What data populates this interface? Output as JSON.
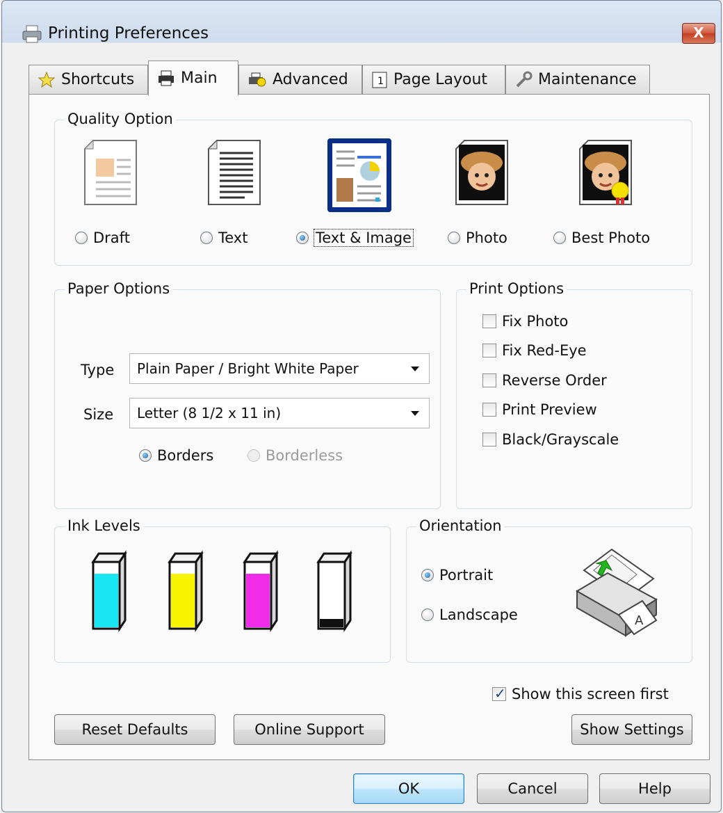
{
  "window": {
    "title": "Printing Preferences",
    "close_label": "X"
  },
  "tabs": [
    {
      "label": "Shortcuts",
      "icon": "star-icon"
    },
    {
      "label": "Main",
      "icon": "printer-icon",
      "active": true
    },
    {
      "label": "Advanced",
      "icon": "gear-printer-icon"
    },
    {
      "label": "Page Layout",
      "icon": "page-number-icon"
    },
    {
      "label": "Maintenance",
      "icon": "wrench-icon"
    }
  ],
  "quality": {
    "legend": "Quality Option",
    "options": [
      "Draft",
      "Text",
      "Text & Image",
      "Photo",
      "Best Photo"
    ],
    "selected": "Text & Image"
  },
  "paper": {
    "legend": "Paper Options",
    "type_label": "Type",
    "type_value": "Plain Paper / Bright White Paper",
    "size_label": "Size",
    "size_value": "Letter (8 1/2 x 11 in)",
    "borders_label": "Borders",
    "borderless_label": "Borderless",
    "selected": "Borders"
  },
  "print_options": {
    "legend": "Print Options",
    "items": [
      "Fix Photo",
      "Fix Red-Eye",
      "Reverse Order",
      "Print Preview",
      "Black/Grayscale"
    ]
  },
  "ink": {
    "legend": "Ink Levels",
    "cartridges": [
      {
        "color": "#19e6f3",
        "level": 0.82
      },
      {
        "color": "#f8f400",
        "level": 0.82
      },
      {
        "color": "#f02ce9",
        "level": 0.82
      },
      {
        "color": "#111111",
        "level": 0.15
      }
    ]
  },
  "orientation": {
    "legend": "Orientation",
    "portrait_label": "Portrait",
    "landscape_label": "Landscape",
    "selected": "Portrait"
  },
  "show_first_label": "Show this screen first",
  "buttons": {
    "reset": "Reset Defaults",
    "online": "Online Support",
    "show_settings": "Show Settings",
    "ok": "OK",
    "cancel": "Cancel",
    "help": "Help"
  }
}
